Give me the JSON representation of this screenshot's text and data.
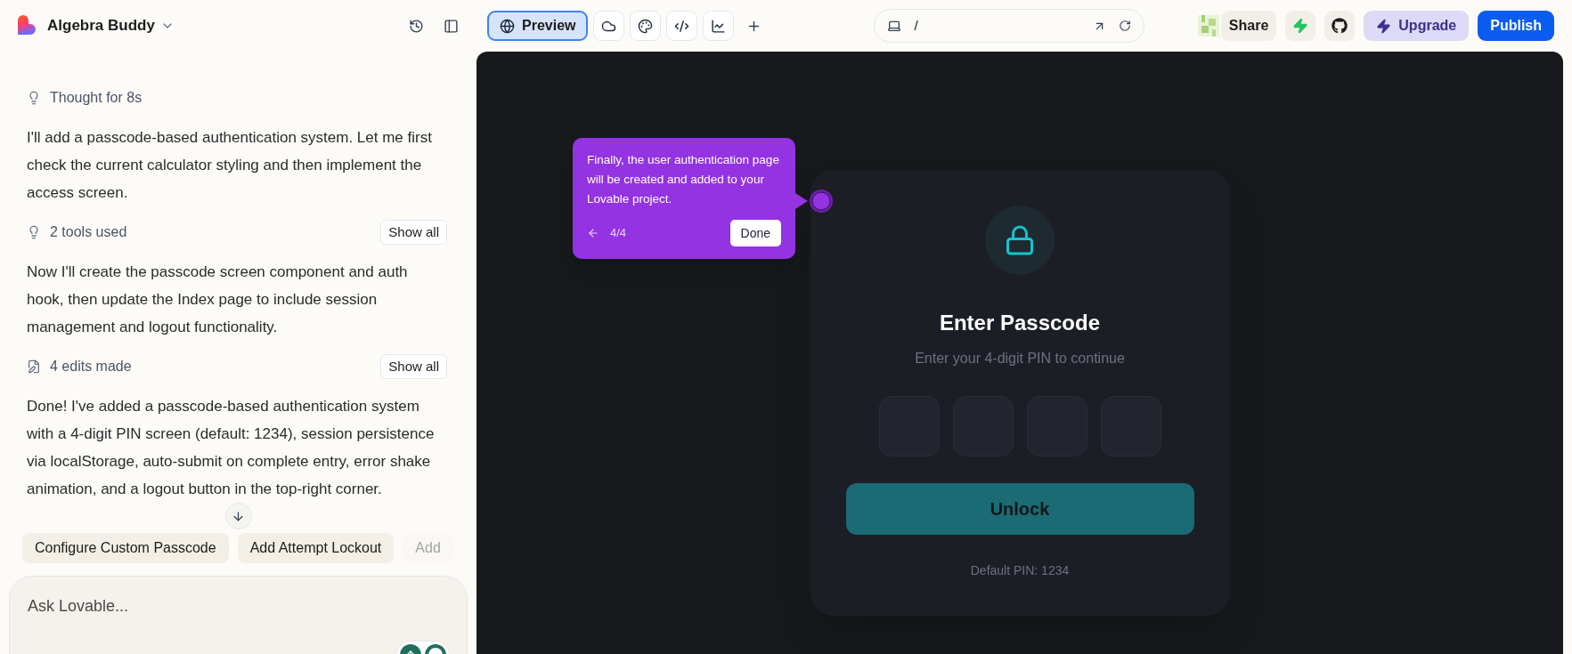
{
  "project": {
    "name": "Algebra Buddy"
  },
  "toolbar": {
    "tabs": [
      {
        "kind": "preview",
        "label": "Preview",
        "selected": true
      },
      {
        "kind": "cloud",
        "selected": false
      },
      {
        "kind": "palette",
        "selected": false
      },
      {
        "kind": "code",
        "selected": false
      },
      {
        "kind": "chart",
        "selected": false
      }
    ]
  },
  "address_bar": {
    "path": "/"
  },
  "actions": {
    "share": "Share",
    "upgrade": "Upgrade",
    "publish": "Publish"
  },
  "chat": {
    "messages": [
      {
        "kind": "thought",
        "text": "Thought for 8s"
      },
      {
        "kind": "text",
        "text": "I'll add a passcode-based authentication system. Let me first check the current calculator styling and then implement the access screen."
      },
      {
        "kind": "tools",
        "text": "2 tools used",
        "button": "Show all"
      },
      {
        "kind": "text",
        "text": "Now I'll create the passcode screen component and auth hook, then update the Index page to include session management and logout functionality."
      },
      {
        "kind": "edits",
        "text": "4 edits made",
        "button": "Show all"
      },
      {
        "kind": "text",
        "text": "Done! I've added a passcode-based authentication system with a 4-digit PIN screen (default: 1234), session persistence via localStorage, auto-submit on complete entry, error shake animation, and a logout button in the top-right corner."
      }
    ],
    "suggestions": [
      {
        "label": "Configure Custom Passcode",
        "faded": false
      },
      {
        "label": "Add Attempt Lockout",
        "faded": false
      },
      {
        "label": "Add",
        "faded": true
      }
    ],
    "input": {
      "placeholder": "Ask Lovable..."
    }
  },
  "tour": {
    "text": "Finally, the user authentication page will be created and added to your Lovable project.",
    "step": "4/4",
    "button": "Done"
  },
  "preview": {
    "title": "Enter Passcode",
    "subtitle": "Enter your 4-digit PIN to continue",
    "pin_boxes": [
      {
        "filled": false
      },
      {
        "filled": false
      },
      {
        "filled": false
      },
      {
        "filled": false
      }
    ],
    "button": "Unlock",
    "hint": "Default PIN: 1234"
  }
}
